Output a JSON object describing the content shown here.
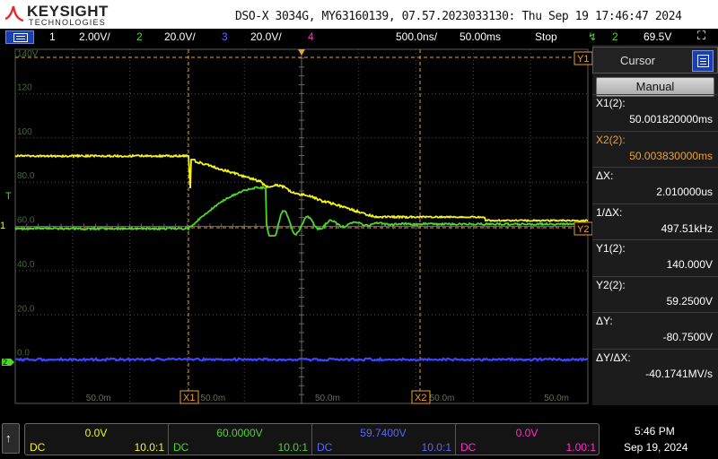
{
  "header": {
    "brand": "KEYSIGHT",
    "brand_sub": "TECHNOLOGIES",
    "title": "DSO-X 3034G, MY63160139, 07.57.2023033130: Thu Sep 19 17:46:47 2024"
  },
  "statusbar": {
    "ch1_num": "1",
    "ch1_scale": "2.00V/",
    "ch2_num": "2",
    "ch2_scale": "20.0V/",
    "ch3_num": "3",
    "ch3_scale": "20.0V/",
    "ch4_num": "4",
    "timebase": "500.0ns/",
    "delay": "50.00ms",
    "run_state": "Stop",
    "trigger_slope": "↯",
    "trigger_source": "2",
    "trigger_level": "69.5V"
  },
  "colors": {
    "ch1": "#f5f51e",
    "ch2": "#4fd62c",
    "ch3": "#3a48ff",
    "ch4": "#ff30c8",
    "cursor": "#f0a028",
    "grid": "#4a4a4a"
  },
  "plot": {
    "y_labels": [
      "140V",
      "120",
      "100",
      "80.0",
      "60.0",
      "40.0",
      "20.0",
      "0.0"
    ],
    "x_labels": [
      "50.0m",
      "50.0m",
      "50.0m",
      "50.0m",
      "50.0m"
    ],
    "cursor_labels": [
      "X1",
      "X2",
      "Y1",
      "Y2"
    ],
    "trigger_marker": "T",
    "ch_markers": [
      "1",
      "2"
    ]
  },
  "panel": {
    "title": "Cursor",
    "mode": "Manual",
    "rows": [
      {
        "label": "X1(2):",
        "value": "50.001820000ms"
      },
      {
        "label": "X2(2):",
        "value": "50.003830000ms"
      },
      {
        "label": "ΔX:",
        "value": "2.010000us"
      },
      {
        "label": "1/ΔX:",
        "value": "497.51kHz"
      },
      {
        "label": "Y1(2):",
        "value": "140.000V"
      },
      {
        "label": "Y2(2):",
        "value": "59.2500V"
      },
      {
        "label": "ΔY:",
        "value": "-80.7500V"
      },
      {
        "label": "ΔY/ΔX:",
        "value": "-40.1741MV/s"
      }
    ]
  },
  "bottom": {
    "up_icon": "↑",
    "channels": [
      {
        "offset": "0.0V",
        "coupling": "DC",
        "probe": "10.0:1"
      },
      {
        "offset": "60.0000V",
        "coupling": "DC",
        "probe": "10.0:1"
      },
      {
        "offset": "59.7400V",
        "coupling": "DC",
        "probe": "10.0:1"
      },
      {
        "offset": "0.0V",
        "coupling": "DC",
        "probe": "1.00:1"
      }
    ],
    "time": "5:46 PM",
    "date": "Sep 19, 2024"
  }
}
